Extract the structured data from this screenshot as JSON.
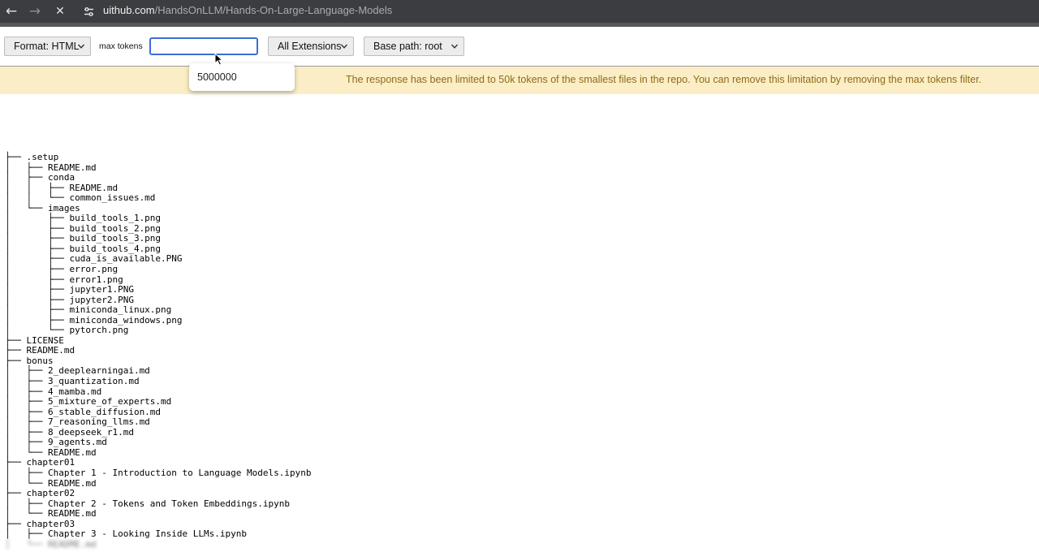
{
  "browser": {
    "url_host": "uithub.com",
    "url_path": "/HandsOnLLM/Hands-On-Large-Language-Models",
    "back_icon": "←",
    "forward_icon": "→",
    "stop_icon": "✕"
  },
  "toolbar": {
    "format_select": "Format: HTML",
    "max_tokens_label": "max tokens",
    "max_tokens_value": "",
    "extensions_select": "All Extensions",
    "base_path_select": "Base path: root"
  },
  "autocomplete": {
    "suggestion": "5000000"
  },
  "banner": {
    "text": "The response has been limited to 50k tokens of the smallest files in the repo. You can remove this limitation by removing the max tokens filter.",
    "color": "#8f6b18",
    "background": "#fbeec6"
  },
  "tree": [
    "├── .setup",
    "│   ├── README.md",
    "│   ├── conda",
    "│   │   ├── README.md",
    "│   │   └── common_issues.md",
    "│   └── images",
    "│       ├── build_tools_1.png",
    "│       ├── build_tools_2.png",
    "│       ├── build_tools_3.png",
    "│       ├── build_tools_4.png",
    "│       ├── cuda_is_available.PNG",
    "│       ├── error.png",
    "│       ├── error1.png",
    "│       ├── jupyter1.PNG",
    "│       ├── jupyter2.PNG",
    "│       ├── miniconda_linux.png",
    "│       ├── miniconda_windows.png",
    "│       └── pytorch.png",
    "├── LICENSE",
    "├── README.md",
    "├── bonus",
    "│   ├── 2_deeplearningai.md",
    "│   ├── 3_quantization.md",
    "│   ├── 4_mamba.md",
    "│   ├── 5_mixture_of_experts.md",
    "│   ├── 6_stable_diffusion.md",
    "│   ├── 7_reasoning_llms.md",
    "│   ├── 8_deepseek_r1.md",
    "│   ├── 9_agents.md",
    "│   └── README.md",
    "├── chapter01",
    "│   ├── Chapter 1 - Introduction to Language Models.ipynb",
    "│   └── README.md",
    "├── chapter02",
    "│   ├── Chapter 2 - Tokens and Token Embeddings.ipynb",
    "│   └── README.md",
    "├── chapter03",
    "│   ├── Chapter 3 - Looking Inside LLMs.ipynb",
    "│   └── README.md"
  ]
}
